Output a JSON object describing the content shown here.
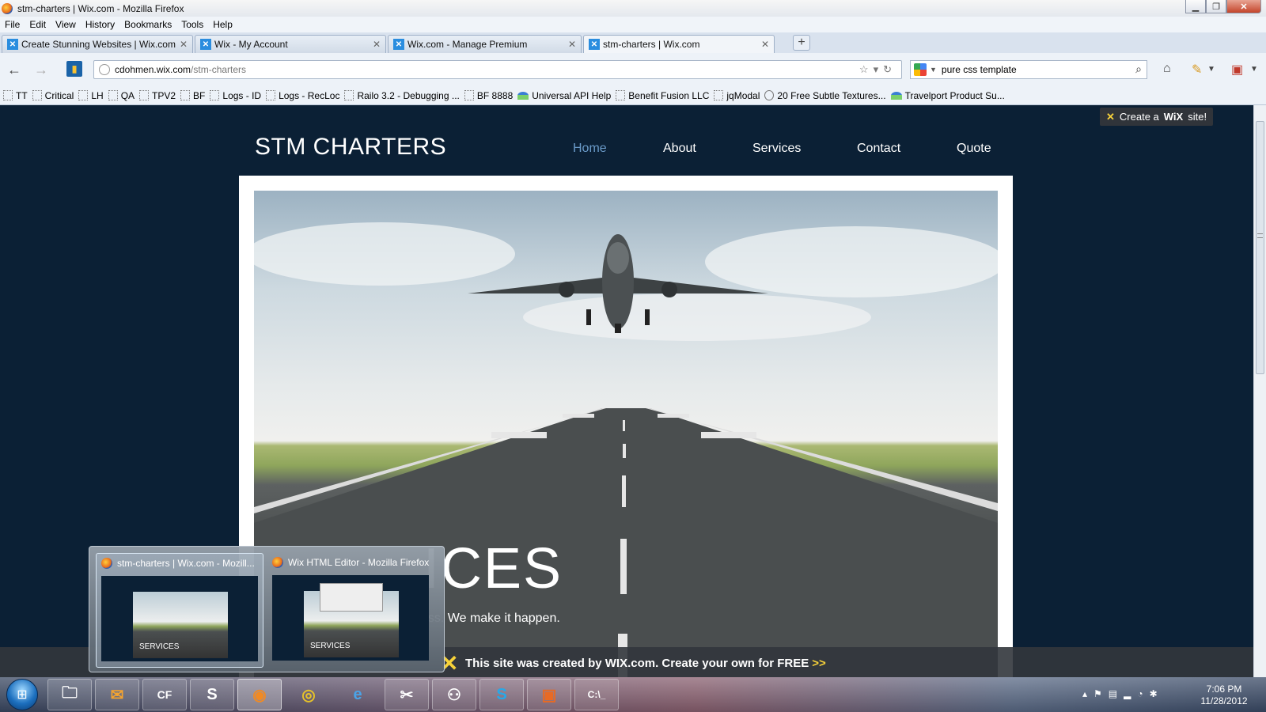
{
  "window": {
    "title": "stm-charters | Wix.com - Mozilla Firefox",
    "minimize_icon": "minimize-icon",
    "maximize_icon": "restore-icon",
    "close_icon": "close-icon"
  },
  "menu": [
    "File",
    "Edit",
    "View",
    "History",
    "Bookmarks",
    "Tools",
    "Help"
  ],
  "tabs": [
    {
      "label": "Create Stunning Websites | Wix.com",
      "active": false
    },
    {
      "label": "Wix - My Account",
      "active": false
    },
    {
      "label": "Wix.com - Manage Premium",
      "active": false
    },
    {
      "label": "stm-charters | Wix.com",
      "active": true
    }
  ],
  "new_tab_label": "+",
  "address": {
    "domain": "cdohmen.wix.com",
    "path": "/stm-charters"
  },
  "search": {
    "value": "pure css template"
  },
  "bookmarks": [
    {
      "label": "TT",
      "icon": "page-icon"
    },
    {
      "label": "Critical",
      "icon": "page-icon"
    },
    {
      "label": "LH",
      "icon": "page-icon"
    },
    {
      "label": "QA",
      "icon": "page-icon"
    },
    {
      "label": "TPV2",
      "icon": "page-icon"
    },
    {
      "label": "BF",
      "icon": "page-icon"
    },
    {
      "label": "Logs - ID",
      "icon": "page-icon"
    },
    {
      "label": "Logs - RecLoc",
      "icon": "page-icon"
    },
    {
      "label": "Railo 3.2 - Debugging ...",
      "icon": "page-icon"
    },
    {
      "label": "BF 8888",
      "icon": "page-icon"
    },
    {
      "label": "Universal API Help",
      "icon": "travelport-icon"
    },
    {
      "label": "Benefit Fusion LLC",
      "icon": "page-icon"
    },
    {
      "label": "jqModal",
      "icon": "page-icon"
    },
    {
      "label": "20 Free Subtle Textures...",
      "icon": "wordpress-icon"
    },
    {
      "label": "Travelport Product Su...",
      "icon": "travelport-icon"
    }
  ],
  "site": {
    "create_wix": {
      "prefix": "Create a",
      "brand": "WiX",
      "suffix": "site!"
    },
    "title": "STM CHARTERS",
    "nav": [
      "Home",
      "About",
      "Services",
      "Contact",
      "Quote"
    ],
    "active_nav": "Home",
    "hero_title": "ICES",
    "hero_subtitle": "ess. We make it happen.",
    "footer_text": "This site was created by WIX.com. Create your own for FREE",
    "footer_arrow": ">>"
  },
  "taskbar_previews": [
    {
      "title": "stm-charters | Wix.com - Mozill...",
      "thumb_label": "SERVICES",
      "active": true
    },
    {
      "title": "Wix HTML Editor - Mozilla Firefox",
      "thumb_label": "SERVICES",
      "active": false
    }
  ],
  "taskbar": {
    "apps": [
      "windows-explorer-icon",
      "outlook-icon",
      "coldfusion-icon",
      "sublime-icon",
      "firefox-icon",
      "chrome-icon",
      "internet-explorer-icon",
      "tools-icon",
      "network-icon",
      "skype-icon",
      "remote-desktop-icon",
      "command-prompt-icon"
    ],
    "cf_label": "CF",
    "clock_time": "7:06 PM",
    "clock_date": "11/28/2012"
  },
  "colors": {
    "page_bg": "#0b2035",
    "nav_active": "#6a9ac8",
    "wix_yellow": "#f7d23a"
  }
}
